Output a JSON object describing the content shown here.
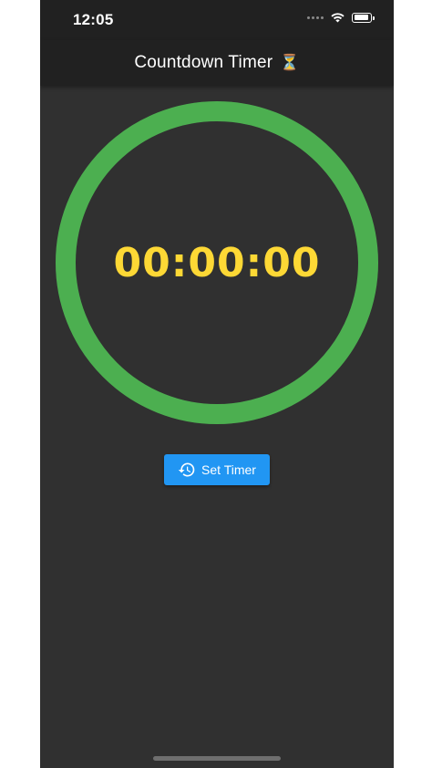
{
  "status_bar": {
    "time": "12:05",
    "icons": [
      "cellular-signal-icon",
      "wifi-icon",
      "battery-icon"
    ],
    "battery_level": 0.9
  },
  "app_bar": {
    "title": "Countdown Timer",
    "emoji": "⏳"
  },
  "timer": {
    "display": "00:00:00",
    "progress": 1.0
  },
  "set_timer_button": {
    "label": "Set Timer",
    "icon": "history-icon"
  },
  "colors": {
    "background": "#303030",
    "app_bar": "#212121",
    "ring": "#4caf50",
    "timer_text": "#fdd835",
    "button": "#2196f3",
    "button_text": "#ffffff"
  }
}
